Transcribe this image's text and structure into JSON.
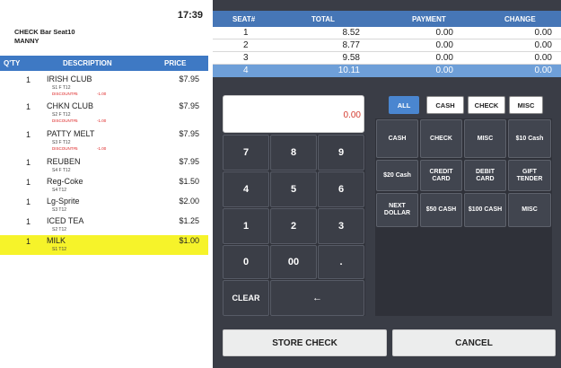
{
  "header": {
    "time": "17:39",
    "check_title": "CHECK Bar Seat10",
    "server": "MANNY"
  },
  "columns": {
    "qty": "Q'TY",
    "description": "DESCRIPTION",
    "price": "PRICE"
  },
  "items": [
    {
      "qty": "1",
      "name": "IRISH CLUB",
      "sub": "S1 F T12",
      "discount": "DISCOUNT#5",
      "discount_amt": "-1.00",
      "price": "$7.95",
      "highlighted": false
    },
    {
      "qty": "1",
      "name": "CHKN CLUB",
      "sub": "S2 F T12",
      "discount": "DISCOUNT#5",
      "discount_amt": "-1.00",
      "price": "$7.95",
      "highlighted": false
    },
    {
      "qty": "1",
      "name": "PATTY MELT",
      "sub": "S3 F T12",
      "discount": "DISCOUNT#5",
      "discount_amt": "-1.00",
      "price": "$7.95",
      "highlighted": false
    },
    {
      "qty": "1",
      "name": "REUBEN",
      "sub": "S4 F T12",
      "discount": "",
      "discount_amt": "",
      "price": "$7.95",
      "highlighted": false
    },
    {
      "qty": "1",
      "name": "Reg-Coke",
      "sub": "S4 T12",
      "discount": "",
      "discount_amt": "",
      "price": "$1.50",
      "highlighted": false
    },
    {
      "qty": "1",
      "name": "Lg-Sprite",
      "sub": "S3 T12",
      "discount": "",
      "discount_amt": "",
      "price": "$2.00",
      "highlighted": false
    },
    {
      "qty": "1",
      "name": "ICED TEA",
      "sub": "S2 T12",
      "discount": "",
      "discount_amt": "",
      "price": "$1.25",
      "highlighted": false
    },
    {
      "qty": "1",
      "name": "MILK",
      "sub": "S1 T12",
      "discount": "",
      "discount_amt": "",
      "price": "$1.00",
      "highlighted": true
    }
  ],
  "seat_table": {
    "headers": {
      "seat": "SEAT#",
      "total": "TOTAL",
      "payment": "PAYMENT",
      "change": "CHANGE"
    },
    "rows": [
      {
        "seat": "1",
        "total": "8.52",
        "payment": "0.00",
        "change": "0.00",
        "selected": false
      },
      {
        "seat": "2",
        "total": "8.77",
        "payment": "0.00",
        "change": "0.00",
        "selected": false
      },
      {
        "seat": "3",
        "total": "9.58",
        "payment": "0.00",
        "change": "0.00",
        "selected": false
      },
      {
        "seat": "4",
        "total": "10.11",
        "payment": "0.00",
        "change": "0.00",
        "selected": true
      }
    ]
  },
  "display_value": "0.00",
  "keypad": {
    "k7": "7",
    "k8": "8",
    "k9": "9",
    "k4": "4",
    "k5": "5",
    "k6": "6",
    "k1": "1",
    "k2": "2",
    "k3": "3",
    "k0": "0",
    "k00": "00",
    "dot": ".",
    "clear": "CLEAR",
    "backspace": "←"
  },
  "tabs": {
    "all": "ALL",
    "cash": "CASH",
    "check": "CHECK",
    "misc": "MISC"
  },
  "payment_buttons": {
    "cash": "CASH",
    "check": "CHECK",
    "misc": "MISC",
    "ten_cash": "$10 Cash",
    "twenty_cash": "$20 Cash",
    "credit_card": "CREDIT CARD",
    "debit_card": "DEBIT CARD",
    "gift_tender": "GIFT TENDER",
    "next_dollar": "NEXT DOLLAR",
    "fifty_cash": "$50 CASH",
    "hundred_cash": "$100 CASH",
    "misc2": "MISC"
  },
  "actions": {
    "store_check": "STORE CHECK",
    "cancel": "CANCEL"
  },
  "colors": {
    "header_blue": "#3e79c4",
    "highlight_yellow": "#f6f32a",
    "panel_dark": "#3a3d46",
    "display_red": "#d43b2e"
  }
}
